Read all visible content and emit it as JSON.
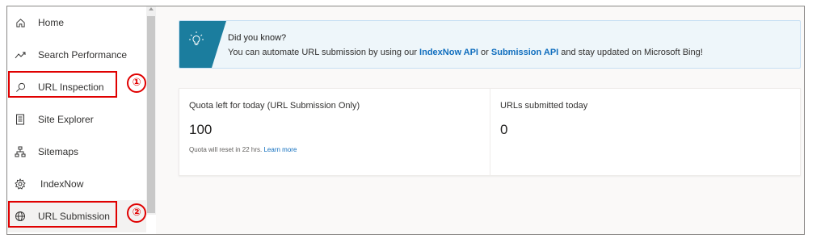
{
  "sidebar": {
    "items": [
      {
        "label": "Home",
        "icon": "home-icon"
      },
      {
        "label": "Search Performance",
        "icon": "trend-icon"
      },
      {
        "label": "URL Inspection",
        "icon": "search-icon"
      },
      {
        "label": "Site Explorer",
        "icon": "document-icon"
      },
      {
        "label": "Sitemaps",
        "icon": "sitemap-icon"
      },
      {
        "label": "IndexNow",
        "icon": "gear-icon"
      },
      {
        "label": "URL Submission",
        "icon": "globe-icon"
      }
    ],
    "selected": "URL Submission"
  },
  "banner": {
    "title": "Did you know?",
    "text_before": "You can automate URL submission by using our ",
    "link1": "IndexNow API",
    "text_middle": " or ",
    "link2": "Submission API",
    "text_after": " and stay updated on Microsoft Bing!",
    "icon": "lightbulb-icon",
    "accent_color": "#1b7d9e"
  },
  "quota": {
    "label": "Quota left for today (URL Submission Only)",
    "value": "100",
    "reset_text": "Quota will reset in 22 hrs. ",
    "learn_more": "Learn more"
  },
  "submitted": {
    "label": "URLs submitted today",
    "value": "0"
  },
  "annotations": {
    "marker1": "①",
    "marker2": "②",
    "color": "#e00000"
  }
}
